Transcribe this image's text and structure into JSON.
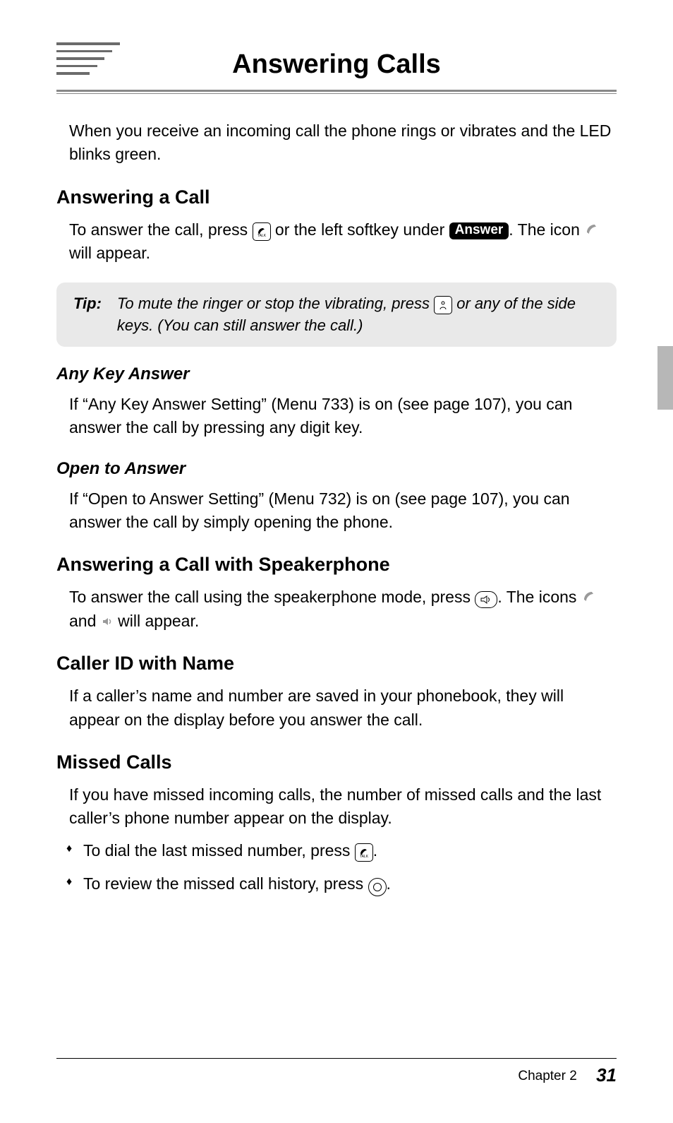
{
  "title": "Answering Calls",
  "intro": "When you receive an incoming call the phone rings or vibrates and the LED blinks green.",
  "sections": {
    "answerCall": {
      "heading": "Answering a Call",
      "text_a": "To answer the call, press ",
      "text_b": " or the left softkey under ",
      "answer_label": "Answer",
      "text_c": ".  The icon ",
      "text_d": " will appear."
    },
    "tip": {
      "label": "Tip:",
      "text_a": "To mute the ringer or stop the vibrating, press ",
      "text_b": " or any of the side keys. (You can still answer the call.)"
    },
    "anyKey": {
      "heading": "Any Key Answer",
      "text": "If “Any Key Answer Setting” (Menu 733) is on (see page 107), you can answer the call by pressing any digit key."
    },
    "openToAnswer": {
      "heading": "Open to Answer",
      "text": "If “Open to Answer Setting” (Menu 732) is on (see page 107), you can answer the call by simply opening the phone."
    },
    "speakerphone": {
      "heading": "Answering a Call with Speakerphone",
      "text_a": "To answer the call using the speakerphone mode, press ",
      "text_b": ". The icons ",
      "text_c": " and ",
      "text_d": " will appear."
    },
    "callerId": {
      "heading": "Caller ID with Name",
      "text": "If a caller’s name and number are saved in your phonebook, they will appear on the display before you answer the call."
    },
    "missed": {
      "heading": "Missed Calls",
      "text": "If you have missed incoming calls, the number of missed calls and the last caller’s phone number appear on the display.",
      "bullets": {
        "b1a": "To dial the last missed number, press ",
        "b1b": ".",
        "b2a": "To review the missed call history, press ",
        "b2b": "."
      }
    }
  },
  "footer": {
    "chapter": "Chapter 2",
    "page": "31"
  },
  "icons": {
    "talk_key": "TALK",
    "end_key": "END",
    "speaker_key": "SPK"
  }
}
